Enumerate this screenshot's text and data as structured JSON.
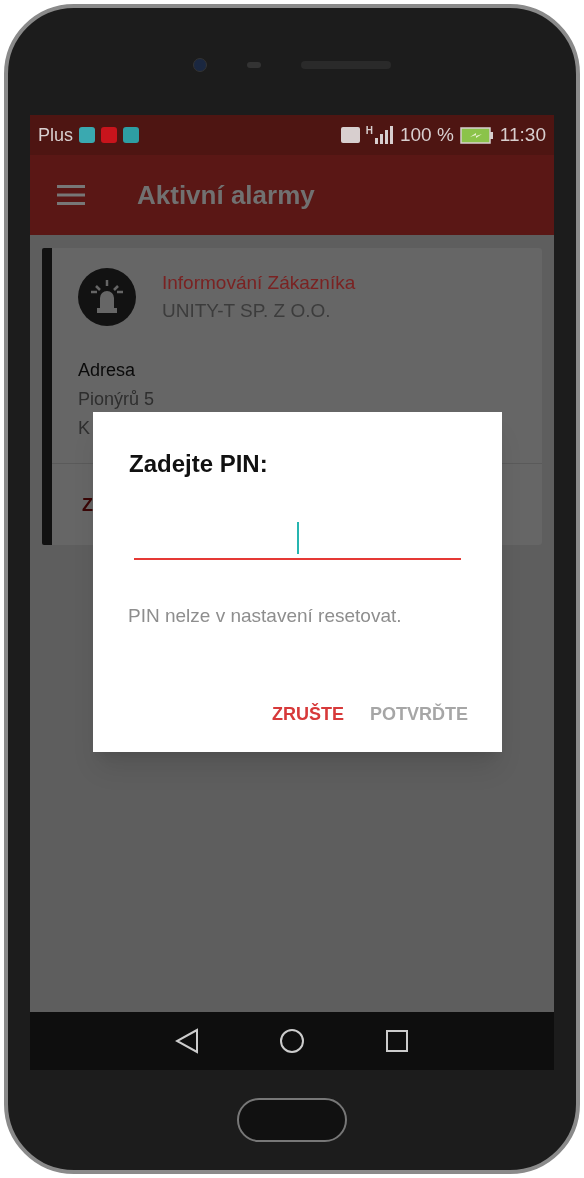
{
  "status_bar": {
    "carrier": "Plus",
    "network_type": "H",
    "battery": "100 %",
    "time": "11:30"
  },
  "app_bar": {
    "title": "Aktivní alarmy"
  },
  "alarm_card": {
    "title": "Informování Zákazníka",
    "company": "UNITY-T SP. Z O.O.",
    "address_label": "Adresa",
    "address_lines": [
      "Pionýrů 5",
      "K"
    ],
    "action": "Z"
  },
  "dialog": {
    "title": "Zadejte PIN:",
    "pin_field": {
      "focused": true
    },
    "message": "PIN nelze v nastavení resetovat.",
    "buttons": [
      {
        "label": "ZRUŠTE",
        "disabled": false
      },
      {
        "label": "POTVRĎTE",
        "disabled": true
      }
    ]
  }
}
